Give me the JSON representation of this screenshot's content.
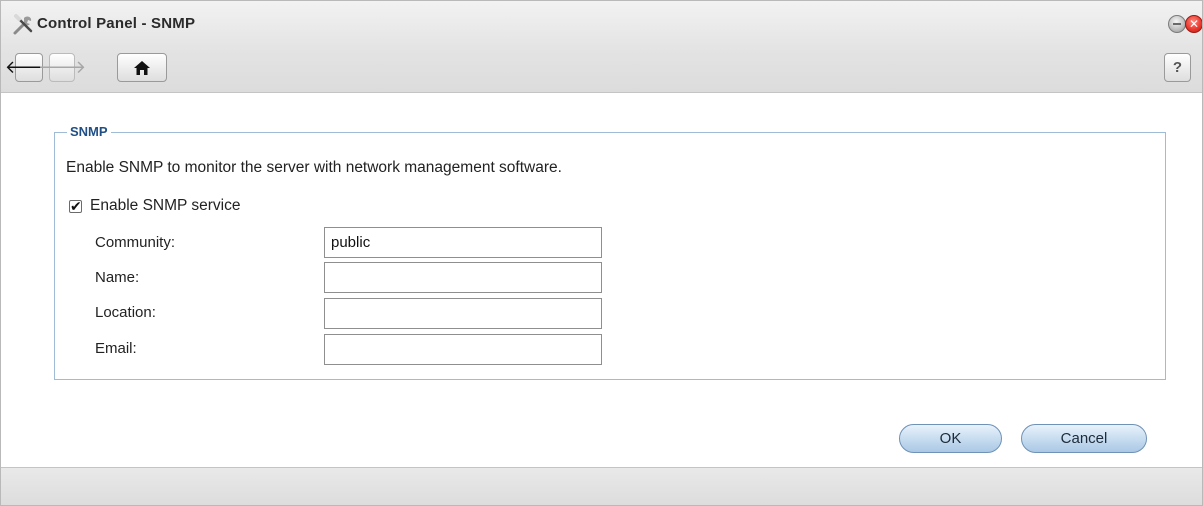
{
  "window": {
    "title": "Control Panel - SNMP",
    "title_icon": "tools-icon",
    "controls": {
      "minimize_icon": "minimize-icon",
      "close_glyph": "✕"
    }
  },
  "toolbar": {
    "back_glyph": "🡐",
    "forward_glyph": "🡒",
    "home_glyph": "⌂",
    "help_glyph": "?"
  },
  "snmp": {
    "legend": "SNMP",
    "description": "Enable SNMP to monitor the server with network management software.",
    "enable_checkbox": {
      "label": "Enable SNMP service",
      "checked": true,
      "glyph": "✔"
    },
    "fields": [
      {
        "label": "Community:",
        "value": "public"
      },
      {
        "label": "Name:",
        "value": ""
      },
      {
        "label": "Location:",
        "value": ""
      },
      {
        "label": "Email:",
        "value": ""
      }
    ]
  },
  "buttons": {
    "ok": "OK",
    "cancel": "Cancel"
  },
  "colors": {
    "accent": "#1f4f86",
    "fieldset_border": "#9fbbd6",
    "button_fill": "#c5dbef"
  }
}
